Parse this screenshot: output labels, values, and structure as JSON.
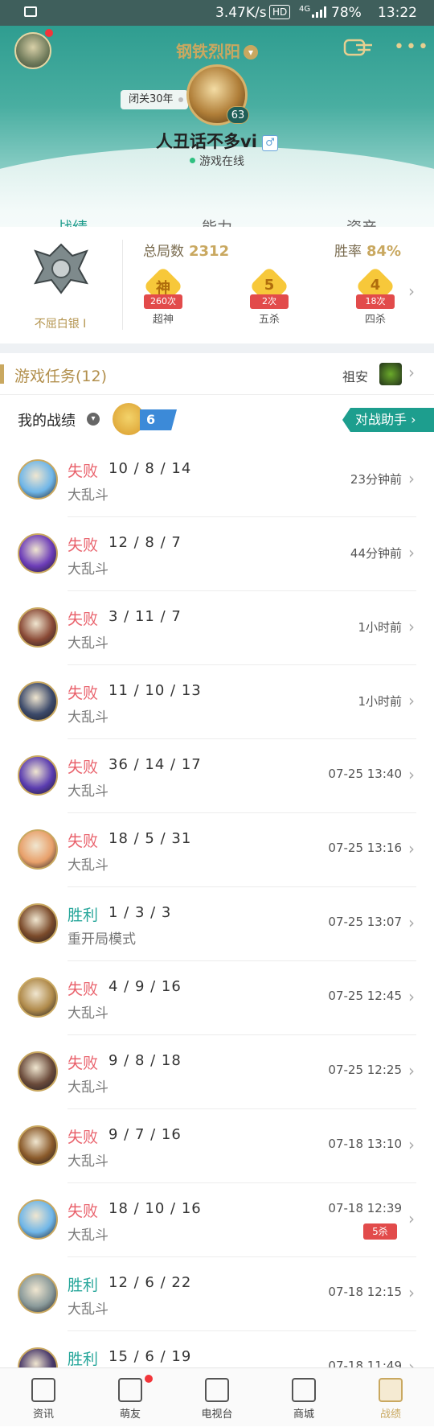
{
  "status_bar": {
    "speed": "3.47K/s",
    "hd": "HD",
    "signal": "4G",
    "battery": "78%",
    "time": "13:22"
  },
  "header": {
    "server": "钢铁烈阳",
    "closed_label": "闭关30年",
    "level": "63",
    "nickname": "人丑话不多vi",
    "online": "游戏在线"
  },
  "tabs": [
    {
      "label": "战绩"
    },
    {
      "label": "能力"
    },
    {
      "label": "资产"
    }
  ],
  "rank": {
    "tier": "不屈白银 I",
    "games_label": "总局数",
    "games": "2312",
    "winrate_label": "胜率",
    "winrate": "84%",
    "badges": [
      {
        "symbol": "神",
        "count": "260次",
        "label": "超神"
      },
      {
        "symbol": "5",
        "count": "2次",
        "label": "五杀"
      },
      {
        "symbol": "4",
        "count": "18次",
        "label": "四杀"
      }
    ]
  },
  "tasks": {
    "title": "游戏任务(12)",
    "npc": "祖安"
  },
  "my_record": {
    "title": "我的战绩",
    "streak": "6",
    "assistant": "对战助手 ›"
  },
  "matches": [
    {
      "result": "失败",
      "kda": "10 / 8 / 14",
      "mode": "大乱斗",
      "time": "23分钟前",
      "hero_color": "#6fb6e8",
      "win": false
    },
    {
      "result": "失败",
      "kda": "12 / 8 / 7",
      "mode": "大乱斗",
      "time": "44分钟前",
      "hero_color": "#6c3cb8",
      "win": false
    },
    {
      "result": "失败",
      "kda": "3 / 11 / 7",
      "mode": "大乱斗",
      "time": "1小时前",
      "hero_color": "#8a4a36",
      "win": false
    },
    {
      "result": "失败",
      "kda": "11 / 10 / 13",
      "mode": "大乱斗",
      "time": "1小时前",
      "hero_color": "#3c4a6a",
      "win": false
    },
    {
      "result": "失败",
      "kda": "36 / 14 / 17",
      "mode": "大乱斗",
      "time": "07-25 13:40",
      "hero_color": "#5a3cb0",
      "win": false
    },
    {
      "result": "失败",
      "kda": "18 / 5 / 31",
      "mode": "大乱斗",
      "time": "07-25 13:16",
      "hero_color": "#e8a06a",
      "win": false
    },
    {
      "result": "胜利",
      "kda": "1 / 3 / 3",
      "mode": "重开局模式",
      "time": "07-25 13:07",
      "hero_color": "#7a4a2a",
      "win": true
    },
    {
      "result": "失败",
      "kda": "4 / 9 / 16",
      "mode": "大乱斗",
      "time": "07-25 12:45",
      "hero_color": "#b08a4a",
      "win": false
    },
    {
      "result": "失败",
      "kda": "9 / 8 / 18",
      "mode": "大乱斗",
      "time": "07-25 12:25",
      "hero_color": "#6a4a3a",
      "win": false
    },
    {
      "result": "失败",
      "kda": "9 / 7 / 16",
      "mode": "大乱斗",
      "time": "07-18 13:10",
      "hero_color": "#8a5a2a",
      "win": false
    },
    {
      "result": "失败",
      "kda": "18 / 10 / 16",
      "mode": "大乱斗",
      "time": "07-18 12:39",
      "hero_color": "#6fb6e8",
      "win": false,
      "five": "5杀"
    },
    {
      "result": "胜利",
      "kda": "12 / 6 / 22",
      "mode": "大乱斗",
      "time": "07-18 12:15",
      "hero_color": "#8a9a9a",
      "win": true
    },
    {
      "result": "胜利",
      "kda": "15 / 6 / 19",
      "mode": "",
      "time": "07-18 11:49",
      "hero_color": "#4a3a6a",
      "win": true
    }
  ],
  "bottom_nav": [
    {
      "label": "资讯",
      "icon": "news-icon"
    },
    {
      "label": "萌友",
      "icon": "friends-icon",
      "dot": true
    },
    {
      "label": "电视台",
      "icon": "tv-icon"
    },
    {
      "label": "商城",
      "icon": "shop-icon"
    },
    {
      "label": "战绩",
      "icon": "record-icon",
      "active": true
    }
  ]
}
